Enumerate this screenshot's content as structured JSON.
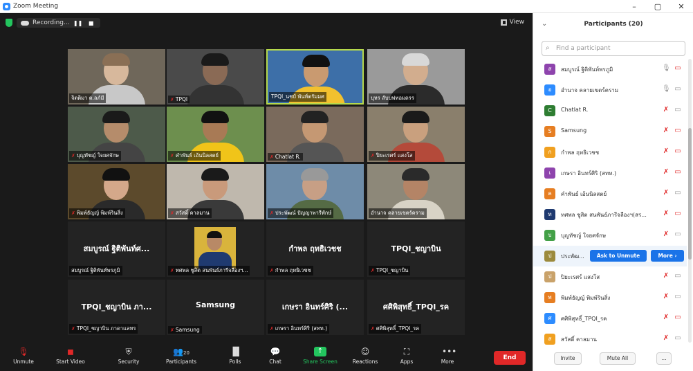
{
  "window": {
    "title": "Zoom Meeting",
    "controls": [
      "–",
      "▢",
      "✕"
    ]
  },
  "topbar": {
    "recording_label": "Recording...",
    "pause_icon": "pause-icon",
    "stop_icon": "stop-icon",
    "view_label": "View"
  },
  "tiles": [
    {
      "name": "จิตติมา ต.ลภ์มี",
      "muted": false,
      "scene": {
        "bg": "#6f675a",
        "skin": "#d7b89c",
        "shirt": "#c8c8c8",
        "hair": "#8a6f55"
      }
    },
    {
      "name": "TPQI",
      "muted": true,
      "scene": {
        "bg": "#4a4a4a",
        "skin": "#8a6a55",
        "shirt": "#333333",
        "hair": "#1a1a1a"
      }
    },
    {
      "name": "TPQI_นชป์ พันท์ตรัมมศ",
      "muted": false,
      "active": true,
      "scene": {
        "bg": "#3d6fa8",
        "skin": "#c99a70",
        "shirt": "#f2c12e",
        "hair": "#111111"
      }
    },
    {
      "name": "บุหร ส์บบฟทอมดรร",
      "muted": false,
      "scene": {
        "bg": "#9a9a9a",
        "skin": "#d2ad8e",
        "shirt": "#2b2b2b",
        "hair": "#d8d8d8"
      }
    },
    {
      "name": "บุญทัชญ์ ใจยศจักษ",
      "muted": true,
      "scene": {
        "bg": "#4d5a4a",
        "skin": "#b58c6b",
        "shirt": "#444444",
        "hair": "#1a1a1a"
      }
    },
    {
      "name": "คำพันธ์ เอ้นนิลสตย์",
      "muted": true,
      "scene": {
        "bg": "#6d8f4e",
        "skin": "#a87a55",
        "shirt": "#f0c419",
        "hair": "#111111"
      }
    },
    {
      "name": "Chatlat R.",
      "muted": true,
      "scene": {
        "bg": "#7a6a5c",
        "skin": "#c59873",
        "shirt": "#555555",
        "hair": "#222222"
      }
    },
    {
      "name": "ปิยะเรศร์ แสงโส",
      "muted": true,
      "scene": {
        "bg": "#8a7f6c",
        "skin": "#c9a07e",
        "shirt": "#b44a3a",
        "hair": "#1a1a1a"
      }
    },
    {
      "name": "พิมพ์ธัญญ์ พิมพ์รินสิ่ง",
      "muted": true,
      "scene": {
        "bg": "#5c4a2c",
        "skin": "#d4a88a",
        "shirt": "#2a2a2a",
        "hair": "#111111"
      }
    },
    {
      "name": "สวัสดิ์ คาลมาน",
      "muted": true,
      "scene": {
        "bg": "#bfb8ad",
        "skin": "#c99a7b",
        "shirt": "#3a3a3a",
        "hair": "#1a1a1a"
      }
    },
    {
      "name": "ประพัฒน์ ปัญญาพารีทักษ์",
      "muted": true,
      "scene": {
        "bg": "#6e8ca8",
        "skin": "#c79f85",
        "shirt": "#556b45",
        "hair": "#999999"
      }
    },
    {
      "name": "อำนาจ คลายเขตร์คราม",
      "muted": false,
      "scene": {
        "bg": "#8d8879",
        "skin": "#b48466",
        "shirt": "#d8d3c6",
        "hair": "#2a2a2a"
      }
    },
    {
      "name": "สมบูรณ์ ฐิติพันท์ศ...",
      "label": "สมบูรณ์ ฐิติพันท์พรภูมิ",
      "muted": false,
      "text_tile": true
    },
    {
      "name": "ทศพล ชูสิต สนพันธ์ภารีจลืองฯ...",
      "muted": true,
      "scene": {
        "bg": "#d9b43c",
        "skin": "#b88966",
        "shirt": "#1f3a70",
        "hair": "#111111"
      },
      "small_video": true
    },
    {
      "name": "กำพล ฤทธิเวชช",
      "label": "กำพล ฤทธิเวชช",
      "muted": true,
      "text_tile": true
    },
    {
      "name": "TPQI_ชญาบิน",
      "label": "TPQI_ชญาบิน",
      "muted": true,
      "text_tile": true
    },
    {
      "name": "TPQI_ชญาบิน ภา...",
      "label": "TPQI_ชญาบิน ภาดาแลทร",
      "muted": true,
      "text_tile": true
    },
    {
      "name": "Samsung",
      "label": "Samsung",
      "muted": true,
      "text_tile": true
    },
    {
      "name": "เกษรา อินทร์ศิริ (...",
      "label": "เกษรา อินทร์ศิริ (สทท.)",
      "muted": true,
      "text_tile": true
    },
    {
      "name": "ศศิพิสุทธิ์_TPQI_รค",
      "label": "ศศิพิสุทธิ์_TPQI_รค",
      "muted": true,
      "text_tile": true
    }
  ],
  "toolbar": {
    "unmute": "Unmute",
    "start_video": "Start Video",
    "security": "Security",
    "participants": "Participants",
    "participants_count": "20",
    "polls": "Polls",
    "chat": "Chat",
    "share_screen": "Share Screen",
    "reactions": "Reactions",
    "apps": "Apps",
    "more": "More",
    "end": "End"
  },
  "panel": {
    "title": "Participants (20)",
    "search_placeholder": "Find a participant",
    "ask_to_unmute": "Ask to Unmute",
    "more": "More ›",
    "invite": "Invite",
    "mute_all": "Mute All",
    "more_dots": "...",
    "participants": [
      {
        "name": "สมบูรณ์ ฐิติพันท์พรภูมิ",
        "initial": "ส",
        "color": "#8e44ad",
        "mic": "on",
        "cam": "off"
      },
      {
        "name": "อำนาจ คลายเขตร์คราม",
        "initial": "อ",
        "color": "#2d8cff",
        "mic": "on",
        "cam": "on",
        "photo": true
      },
      {
        "name": "Chatlat R.",
        "initial": "C",
        "color": "#2e7d32",
        "mic": "off",
        "cam": "on"
      },
      {
        "name": "Samsung",
        "initial": "S",
        "color": "#e67e22",
        "mic": "off",
        "cam": "off"
      },
      {
        "name": "กำพล ฤทธิเวชช",
        "initial": "ก",
        "color": "#f0a020",
        "mic": "off",
        "cam": "off"
      },
      {
        "name": "เกษรา อินทร์ศิริ (สทท.)",
        "initial": "เ",
        "color": "#8e44ad",
        "mic": "off",
        "cam": "off"
      },
      {
        "name": "คำพันธ์ เอ้นนิลสตย์",
        "initial": "ค",
        "color": "#e67e22",
        "mic": "off",
        "cam": "on"
      },
      {
        "name": "ทศพล ชูสิต สนพันธ์ภารีจลืองฯ(สร...",
        "initial": "ท",
        "color": "#1f3a70",
        "mic": "off",
        "cam": "off",
        "photo": true
      },
      {
        "name": "บุญทัชญ์ ใจยศจักษ",
        "initial": "บ",
        "color": "#43a047",
        "mic": "off",
        "cam": "on"
      },
      {
        "name": "ประพัฒ...",
        "initial": "ป",
        "color": "#9c8a3c",
        "mic": "off",
        "cam": "off",
        "photo": true,
        "hover": true
      },
      {
        "name": "ปิยะเรศร์ แสงโส",
        "initial": "ป",
        "color": "#c9a26a",
        "mic": "off",
        "cam": "on",
        "photo": true
      },
      {
        "name": "พิมพ์ธัญญ์ พิมพ์รินสิ่ง",
        "initial": "พ",
        "color": "#e67e22",
        "mic": "off",
        "cam": "on"
      },
      {
        "name": "ศศิพิสุทธิ์_TPQI_รค",
        "initial": "ศ",
        "color": "#2d8cff",
        "mic": "off",
        "cam": "off"
      },
      {
        "name": "สวัสดิ์ คาลมาน",
        "initial": "ส",
        "color": "#f0a020",
        "mic": "off",
        "cam": "on"
      }
    ]
  }
}
